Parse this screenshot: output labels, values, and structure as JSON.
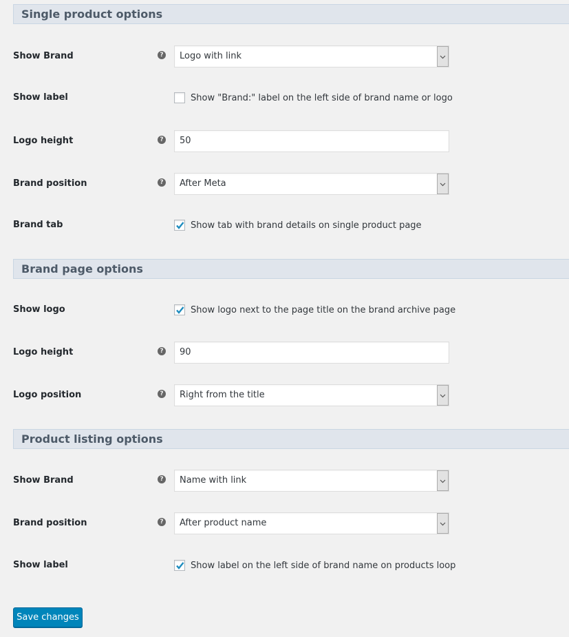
{
  "sections": {
    "single_product": {
      "title": "Single product options",
      "show_brand": {
        "label": "Show Brand",
        "value": "Logo with link"
      },
      "show_label": {
        "label": "Show label",
        "checkbox_text": "Show \"Brand:\" label on the left side of brand name or logo",
        "checked": false
      },
      "logo_height": {
        "label": "Logo height",
        "value": "50"
      },
      "brand_position": {
        "label": "Brand position",
        "value": "After Meta"
      },
      "brand_tab": {
        "label": "Brand tab",
        "checkbox_text": "Show tab with brand details on single product page",
        "checked": true
      }
    },
    "brand_page": {
      "title": "Brand page options",
      "show_logo": {
        "label": "Show logo",
        "checkbox_text": "Show logo next to the page title on the brand archive page",
        "checked": true
      },
      "logo_height": {
        "label": "Logo height",
        "value": "90"
      },
      "logo_position": {
        "label": "Logo position",
        "value": "Right from the title"
      }
    },
    "product_listing": {
      "title": "Product listing options",
      "show_brand": {
        "label": "Show Brand",
        "value": "Name with link"
      },
      "brand_position": {
        "label": "Brand position",
        "value": "After product name"
      },
      "show_label": {
        "label": "Show label",
        "checkbox_text": "Show label on the left side of brand name on products loop",
        "checked": true
      }
    }
  },
  "icons": {
    "help": "question-circle-icon",
    "dropdown": "chevron-down-icon",
    "check": "checkmark-icon"
  },
  "help_glyph": "?",
  "colors": {
    "accent": "#0085ba",
    "check": "#1e8cbe",
    "section_bg": "#e0e5ec"
  },
  "footer": {
    "save_label": "Save changes"
  }
}
